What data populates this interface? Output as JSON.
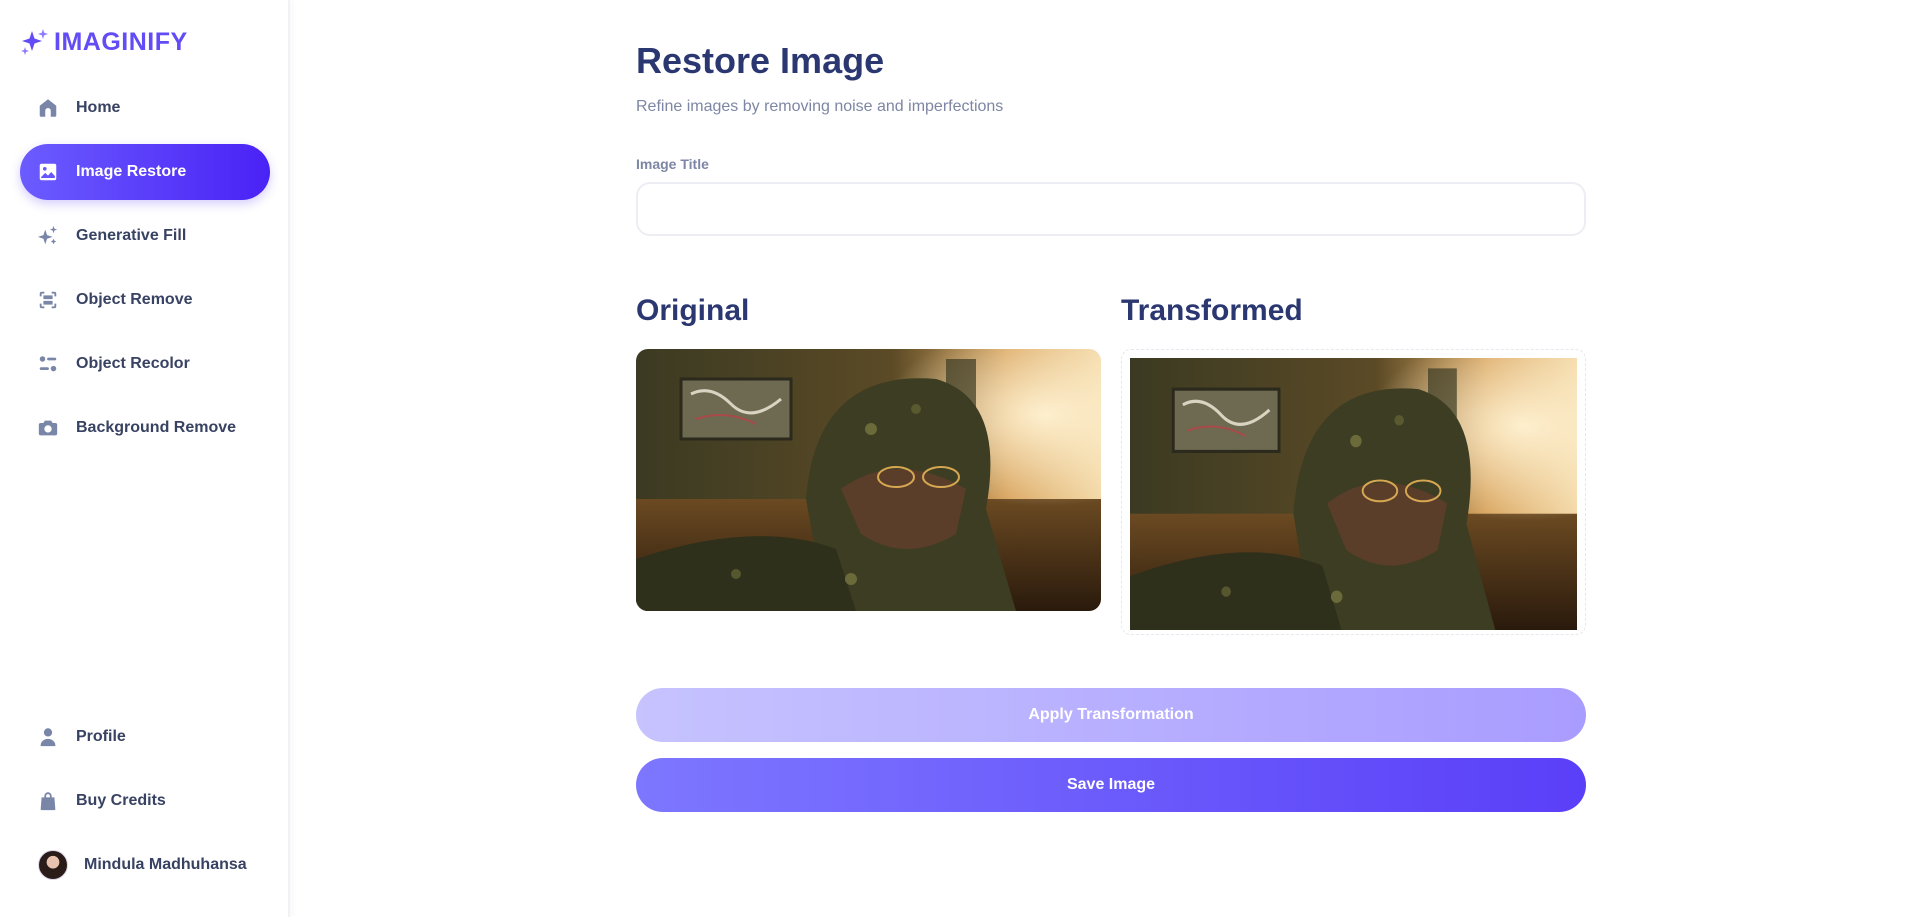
{
  "brand": {
    "name": "IMAGINIFY",
    "accent": "#624cf5"
  },
  "sidebar": {
    "items": [
      {
        "label": "Home",
        "icon": "home-icon",
        "active": false
      },
      {
        "label": "Image Restore",
        "icon": "image-icon",
        "active": true
      },
      {
        "label": "Generative Fill",
        "icon": "sparkles-icon",
        "active": false
      },
      {
        "label": "Object Remove",
        "icon": "scan-icon",
        "active": false
      },
      {
        "label": "Object Recolor",
        "icon": "filter-icon",
        "active": false
      },
      {
        "label": "Background Remove",
        "icon": "camera-icon",
        "active": false
      }
    ],
    "bottom_items": [
      {
        "label": "Profile",
        "icon": "user-icon"
      },
      {
        "label": "Buy Credits",
        "icon": "bag-icon"
      }
    ],
    "user": {
      "name": "Mindula Madhuhansa"
    }
  },
  "main": {
    "title": "Restore Image",
    "subtitle": "Refine images by removing noise and imperfections",
    "form": {
      "title_label": "Image Title",
      "title_value": "",
      "title_placeholder": ""
    },
    "original_heading": "Original",
    "transformed_heading": "Transformed",
    "apply_button": "Apply Transformation",
    "save_button": "Save Image"
  }
}
